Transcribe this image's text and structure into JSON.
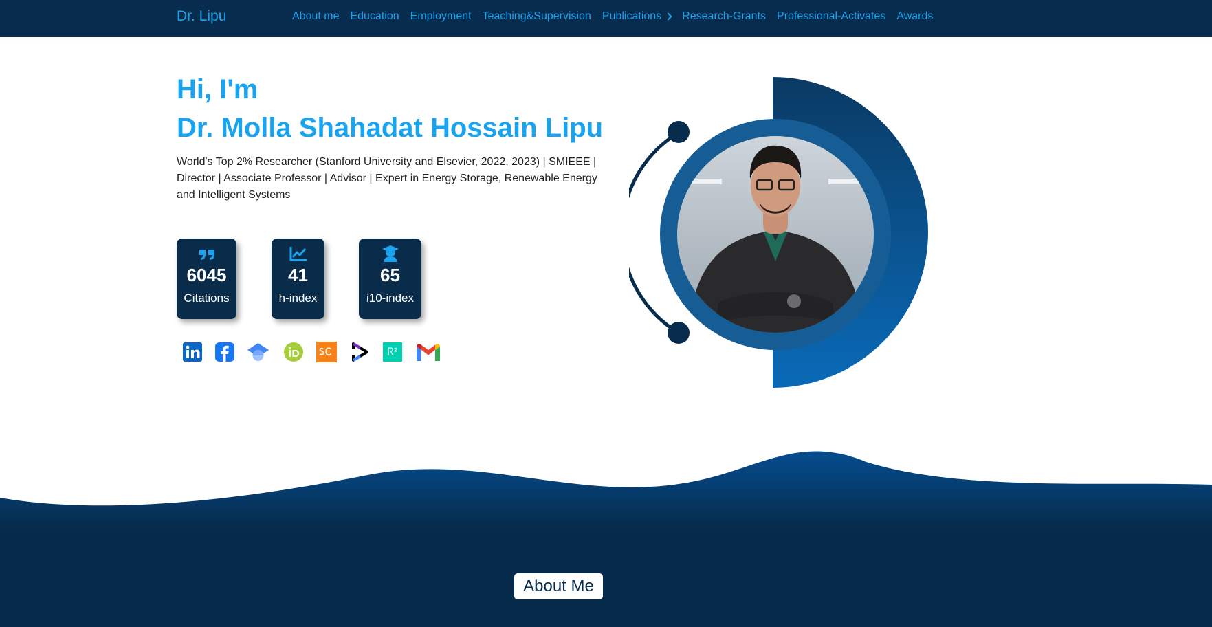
{
  "nav": {
    "brand": "Dr. Lipu",
    "links": [
      {
        "label": "About me"
      },
      {
        "label": "Education"
      },
      {
        "label": "Employment"
      },
      {
        "label": "Teaching&Supervision"
      },
      {
        "label": "Publications"
      },
      {
        "label": "Research-Grants"
      },
      {
        "label": "Professional-Activates"
      },
      {
        "label": "Awards"
      }
    ]
  },
  "hero": {
    "greeting": "Hi, I'm",
    "name": "Dr. Molla Shahadat Hossain Lipu",
    "tagline": "World's Top 2% Researcher (Stanford University and Elsevier, 2022, 2023) | SMIEEE | Director | Associate Professor | Advisor | Expert in Energy Storage, Renewable Energy and Intelligent Systems"
  },
  "stats": [
    {
      "icon": "quote-icon",
      "value": "6045",
      "label": "Citations"
    },
    {
      "icon": "chart-line-icon",
      "value": "41",
      "label": "h-index"
    },
    {
      "icon": "graduate-icon",
      "value": "65",
      "label": "i10-index"
    }
  ],
  "socials": [
    "linkedin-icon",
    "facebook-icon",
    "google-scholar-icon",
    "orcid-icon",
    "scopus-icon",
    "clarivate-icon",
    "researchgate-icon",
    "gmail-icon"
  ],
  "about": {
    "button": "About Me"
  },
  "colors": {
    "nav_bg": "#072c4d",
    "accent": "#1aa3ef",
    "card_bg": "#0a2c4b",
    "wave_top": "#064d8f",
    "wave_bottom": "#062a4a"
  }
}
